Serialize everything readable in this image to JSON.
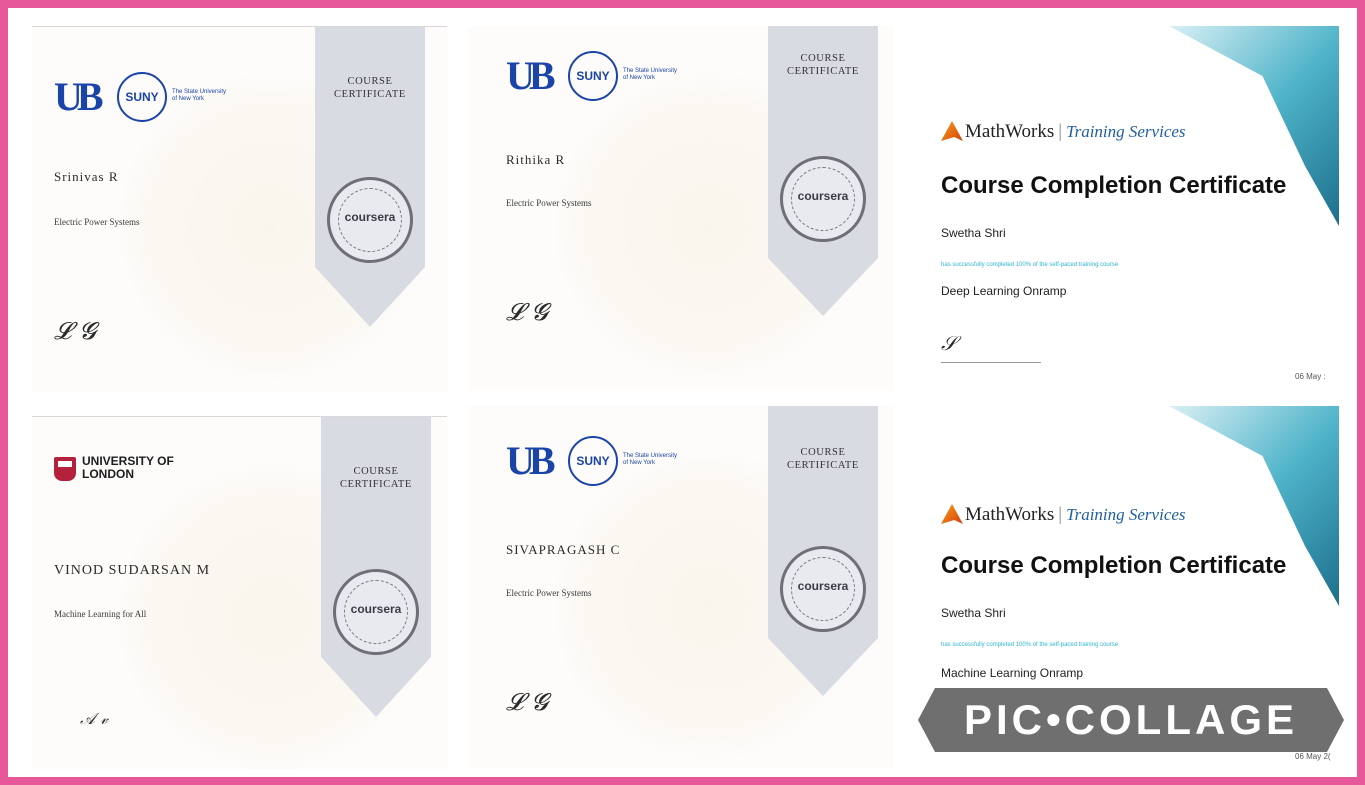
{
  "certificates": [
    {
      "type": "coursera",
      "institution": "SUNY",
      "institution_subtitle": "The State University of New York",
      "ribbon_title": "COURSE CERTIFICATE",
      "seal_text": "coursera",
      "recipient": "Srinivas R",
      "course": "Electric Power Systems"
    },
    {
      "type": "coursera",
      "institution": "SUNY",
      "institution_subtitle": "The State University of New York",
      "ribbon_title": "COURSE CERTIFICATE",
      "seal_text": "coursera",
      "recipient": "Rithika R",
      "course": "Electric Power Systems"
    },
    {
      "type": "mathworks",
      "brand": "MathWorks",
      "separator": "|",
      "service": "Training Services",
      "title": "Course Completion Certificate",
      "recipient": "Swetha Shri",
      "completed_text": "has successfully completed 100% of the self-paced training course",
      "course": "Deep Learning Onramp",
      "date": "06 May :"
    },
    {
      "type": "coursera",
      "institution": "UNIVERSITY OF LONDON",
      "ribbon_title": "COURSE CERTIFICATE",
      "seal_text": "coursera",
      "recipient": "VINOD SUDARSAN M",
      "course": "Machine Learning for All"
    },
    {
      "type": "coursera",
      "institution": "SUNY",
      "institution_subtitle": "The State University of New York",
      "ribbon_title": "COURSE CERTIFICATE",
      "seal_text": "coursera",
      "recipient": "SIVAPRAGASH C",
      "course": "Electric Power Systems"
    },
    {
      "type": "mathworks",
      "brand": "MathWorks",
      "separator": "|",
      "service": "Training Services",
      "title": "Course Completion Certificate",
      "recipient": "Swetha Shri",
      "completed_text": "has successfully completed 100% of the self-paced training course",
      "course": "Machine Learning Onramp",
      "date": "06 May 2("
    }
  ],
  "watermark": "PIC•COLLAGE",
  "colors": {
    "frame": "#e6589a",
    "suny_blue": "#1a44a8",
    "ribbon": "#d9dbe3",
    "mathworks_cyan": "#2eb6d6",
    "london_red": "#b3213a"
  }
}
